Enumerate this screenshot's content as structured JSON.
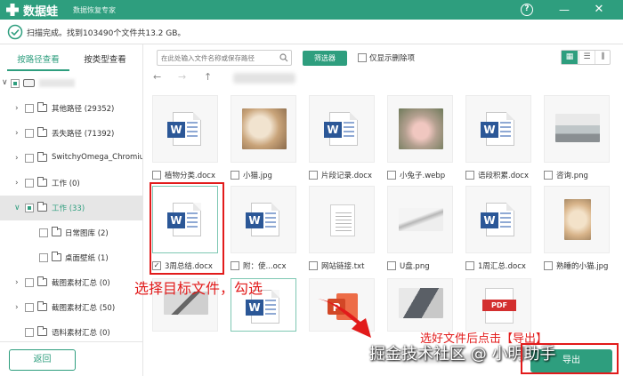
{
  "titlebar": {
    "app_name": "数据蛙",
    "app_subtitle": "数据恢复专家",
    "help": "?",
    "minimize": "—",
    "close": "✕"
  },
  "status": {
    "text": "扫描完成。找到103490个文件共13.2 GB。"
  },
  "sidebar": {
    "tabs": [
      "按路径查看",
      "按类型查看"
    ],
    "active_tab": 0,
    "tree": [
      {
        "label": "其他路径 (29352)"
      },
      {
        "label": "丢失路径 (71392)"
      },
      {
        "label": "SwitchyOmega_Chromium"
      },
      {
        "label": "工作 (0)"
      },
      {
        "label": "工作 (33)",
        "selected": true
      },
      {
        "label": "日常图库 (2)"
      },
      {
        "label": "桌面壁纸 (1)"
      },
      {
        "label": "截图素材汇总 (0)"
      },
      {
        "label": "截图素材汇总 (50)"
      },
      {
        "label": "语料素材汇总 (0)"
      }
    ],
    "back_label": "返回"
  },
  "toolbar": {
    "search_placeholder": "在此处输入文件名称或保存路径",
    "filter_label": "筛选器",
    "deleted_only_label": "仅显示删除项",
    "nav": [
      "←",
      "→",
      "↑"
    ],
    "view_icons": [
      "▦",
      "☰",
      "⫼"
    ]
  },
  "files": {
    "row1": [
      "植物分类.docx",
      "小猫.jpg",
      "片段记录.docx",
      "小兔子.webp",
      "语段积累.docx",
      "咨询.png"
    ],
    "row2": [
      "3周总结.docx",
      "附：使...ocx",
      "网站链接.txt",
      "U盘.png",
      "1周汇总.docx",
      "熟睡的小猫.jpg"
    ],
    "checked_mark": "✓"
  },
  "annotations": {
    "select_hint": "选择目标文件，勾选",
    "export_hint": "选好文件后点击【导出】"
  },
  "footer": {
    "export_label": "导出"
  },
  "watermark": "掘金技术社区 @ 小明助手",
  "colors": {
    "brand": "#2e9e7e",
    "annotation": "#e21b1b",
    "word": "#2b5797",
    "pdf": "#d32f2f",
    "ppt": "#d24726"
  }
}
